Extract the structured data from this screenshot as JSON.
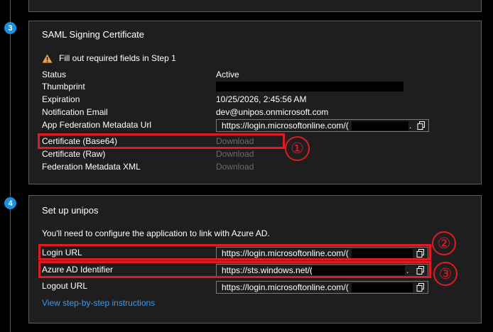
{
  "steps": [
    "3",
    "4"
  ],
  "saml": {
    "title": "SAML Signing Certificate",
    "warning": "Fill out required fields in Step 1",
    "rows": {
      "status_label": "Status",
      "status_value": "Active",
      "thumbprint_label": "Thumbprint",
      "expiration_label": "Expiration",
      "expiration_value": "10/25/2026, 2:45:56 AM",
      "email_label": "Notification Email",
      "email_value": "dev@unipos.onmicrosoft.com",
      "metadata_url_label": "App Federation Metadata Url",
      "metadata_url_value": "https://login.microsoftonline.com/(",
      "metadata_url_tail": ".",
      "cert_b64_label": "Certificate (Base64)",
      "cert_raw_label": "Certificate (Raw)",
      "fed_xml_label": "Federation Metadata XML",
      "download": "Download"
    }
  },
  "setup": {
    "title": "Set up unipos",
    "description": "You'll need to configure the application to link with Azure AD.",
    "login_url_label": "Login URL",
    "login_url_value": "https://login.microsoftonline.com/(",
    "azure_id_label": "Azure AD Identifier",
    "azure_id_value": "https://sts.windows.net/(",
    "azure_id_tail": ".",
    "logout_url_label": "Logout URL",
    "logout_url_value": "https://login.microsoftonline.com/(",
    "instructions_link": "View step-by-step instructions"
  },
  "annotations": [
    "①",
    "②",
    "③"
  ],
  "colors": {
    "background": "#000000",
    "card": "#1e1e1e",
    "step_badge": "#1b8fe0",
    "link": "#3d9bf0",
    "annotation_red": "#e01b24",
    "warning": "#f2a23c"
  }
}
